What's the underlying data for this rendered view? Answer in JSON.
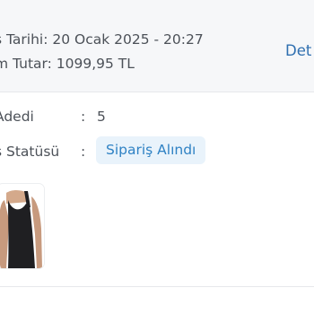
{
  "order": {
    "date_line": "ş Tarihi: 20 Ocak 2025 - 20:27",
    "total_line": "m Tutar: 1099,95 TL",
    "details_link": "Det"
  },
  "info": {
    "quantity": {
      "label": "Adedi",
      "colon": ":",
      "value": "5"
    },
    "status": {
      "label": "ş Statüsü",
      "colon": ":",
      "value": "Sipariş Alındı"
    }
  },
  "product": {
    "image": "black-tank-top-model-photo"
  },
  "colors": {
    "header_bg": "#f6f7f9",
    "link": "#2f6fb0",
    "badge_bg": "#e9f3fb",
    "badge_text": "#2f82c4",
    "text": "#4c5158"
  }
}
